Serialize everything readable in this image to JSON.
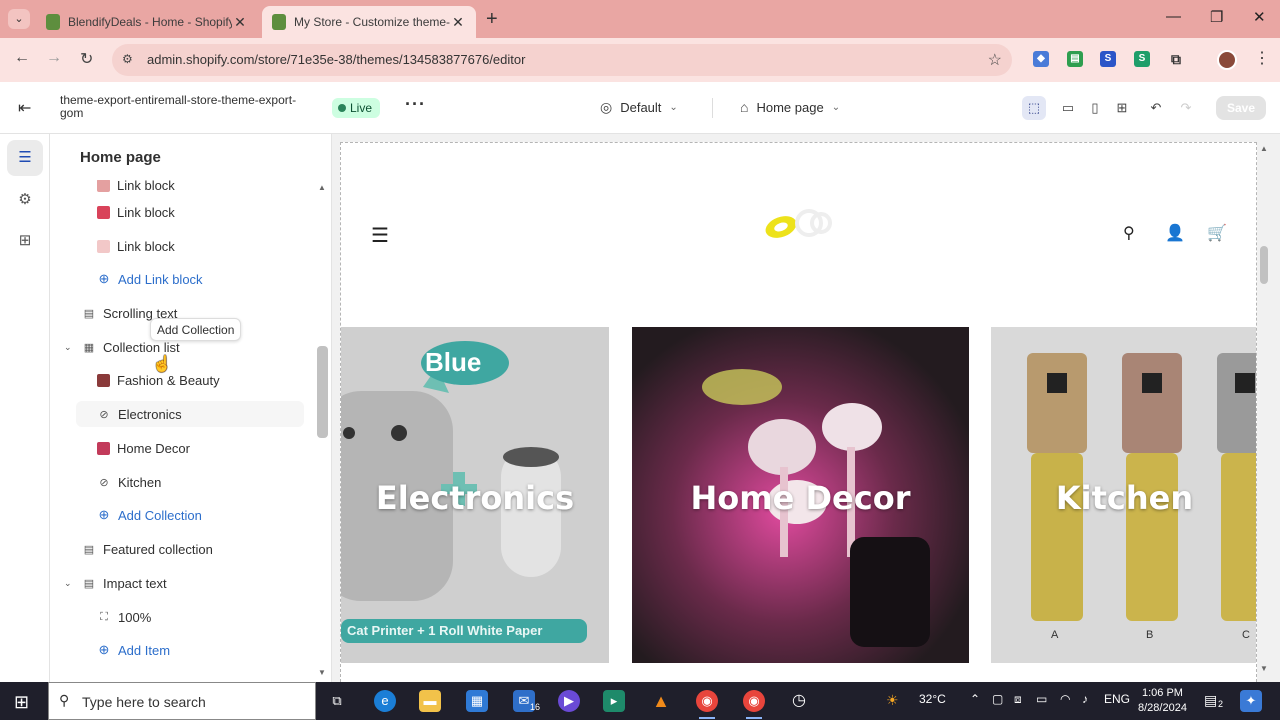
{
  "browser": {
    "tabs": [
      {
        "title": "BlendifyDeals - Home - Shopify"
      },
      {
        "title": "My Store - Customize theme-e"
      }
    ],
    "url": "admin.shopify.com/store/71e35e-38/themes/134583877676/editor"
  },
  "editor": {
    "theme_name": "theme-export-entiremall-store-theme-export-gom",
    "status": "Live",
    "theme_picker": "Default",
    "page_picker": "Home page",
    "save_label": "Save"
  },
  "sidebar": {
    "title": "Home page",
    "tooltip": "Add Collection",
    "items": [
      {
        "label": "Link block"
      },
      {
        "label": "Link block"
      },
      {
        "label": "Link block"
      },
      {
        "label": "Add Link block"
      },
      {
        "label": "Scrolling text"
      },
      {
        "label": "Collection list"
      },
      {
        "label": "Fashion & Beauty"
      },
      {
        "label": "Electronics"
      },
      {
        "label": "Home Decor"
      },
      {
        "label": "Kitchen"
      },
      {
        "label": "Add Collection"
      },
      {
        "label": "Featured collection"
      },
      {
        "label": "Impact text"
      },
      {
        "label": "100%"
      },
      {
        "label": "Add Item"
      }
    ]
  },
  "preview": {
    "cards": [
      {
        "title": "Electronics",
        "bubble": "Blue",
        "banner": "Cat Printer + 1 Roll White Paper"
      },
      {
        "title": "Home Decor"
      },
      {
        "title": "Kitchen",
        "bottle_labels": [
          "A",
          "B",
          "C"
        ]
      }
    ]
  },
  "taskbar": {
    "search_placeholder": "Type here to search",
    "temperature": "32°C",
    "language": "ENG",
    "time": "1:06 PM",
    "date": "8/28/2024",
    "notification_count": "2",
    "mail_badge": "16"
  },
  "colors": {
    "browser_frame": "#e9a6a3",
    "link_blue": "#2c6ecb",
    "live_badge": "#cdfee1"
  }
}
